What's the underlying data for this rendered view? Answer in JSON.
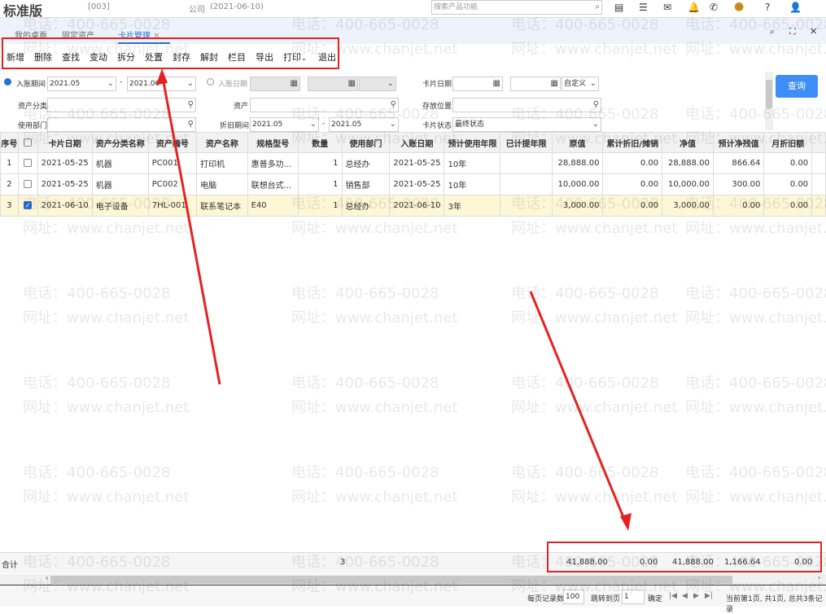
{
  "app": {
    "title": "标准版",
    "company": "[003]",
    "company_suffix": "公司",
    "date": "(2021-06-10)",
    "search_placeholder": "搜索产品功能"
  },
  "tabs": [
    {
      "label": "我的桌面"
    },
    {
      "label": "固定资产"
    },
    {
      "label": "卡片管理",
      "active": true
    }
  ],
  "toolbar": [
    "新增",
    "删除",
    "查找",
    "变动",
    "拆分",
    "处置",
    "封存",
    "解封",
    "栏目",
    "导出",
    "打印",
    "退出"
  ],
  "filters": {
    "entry_period_label": "入账期间",
    "entry_period_from": "2021.05",
    "entry_period_to": "2021.06",
    "entry_date_label": "入账日期",
    "card_date_label": "卡片日期",
    "card_date_mode": "自定义",
    "asset_category_label": "资产分类",
    "asset_label": "资产",
    "location_label": "存放位置",
    "department_label": "使用部门",
    "dep_period_label": "折旧期间",
    "dep_period_from": "2021.05",
    "dep_period_to": "2021.05",
    "card_status_label": "卡片状态",
    "card_status_value": "最终状态",
    "query_button": "查询"
  },
  "table": {
    "headers": [
      "序号",
      "",
      "卡片日期",
      "资产分类名称",
      "资产编号",
      "资产名称",
      "规格型号",
      "数量",
      "使用部门",
      "入账日期",
      "预计使用年限",
      "已计提年限",
      "原值",
      "累计折旧/摊销",
      "净值",
      "预计净残值",
      "月折旧额"
    ],
    "rows": [
      [
        "1",
        false,
        "2021-05-25",
        "机器",
        "PC001",
        "打印机",
        "惠普多功...",
        "1",
        "总经办",
        "2021-05-25",
        "10年",
        "",
        "28,888.00",
        "0.00",
        "28,888.00",
        "866.64",
        "0.00"
      ],
      [
        "2",
        false,
        "2021-05-25",
        "机器",
        "PC002",
        "电脑",
        "联想台式...",
        "1",
        "销售部",
        "2021-05-25",
        "10年",
        "",
        "10,000.00",
        "0.00",
        "10,000.00",
        "300.00",
        "0.00"
      ],
      [
        "3",
        true,
        "2021-06-10",
        "电子设备",
        "7HL-001",
        "联系笔记本",
        "E40",
        "1",
        "总经办",
        "2021-06-10",
        "3年",
        "",
        "3,000.00",
        "0.00",
        "3,000.00",
        "0.00",
        "0.00"
      ]
    ]
  },
  "total": {
    "label": "合计",
    "quantity": "3",
    "original": "41,888.00",
    "accum": "0.00",
    "net": "41,888.00",
    "residual": "1,166.64",
    "monthly": "0.00"
  },
  "pager": {
    "per_page_label": "每页记录数",
    "per_page": "100",
    "jump_label": "跳转到页",
    "jump_page": "1",
    "confirm": "确定",
    "status": "当前第1页, 共1页, 总共3条记录"
  },
  "watermark": {
    "phone": "电话：400-665-0028",
    "site": "网址：www.chanjet.net"
  },
  "colors": {
    "accent": "#2a6fd6",
    "annotation": "#e52222",
    "selected_row": "#fdf7d6"
  }
}
